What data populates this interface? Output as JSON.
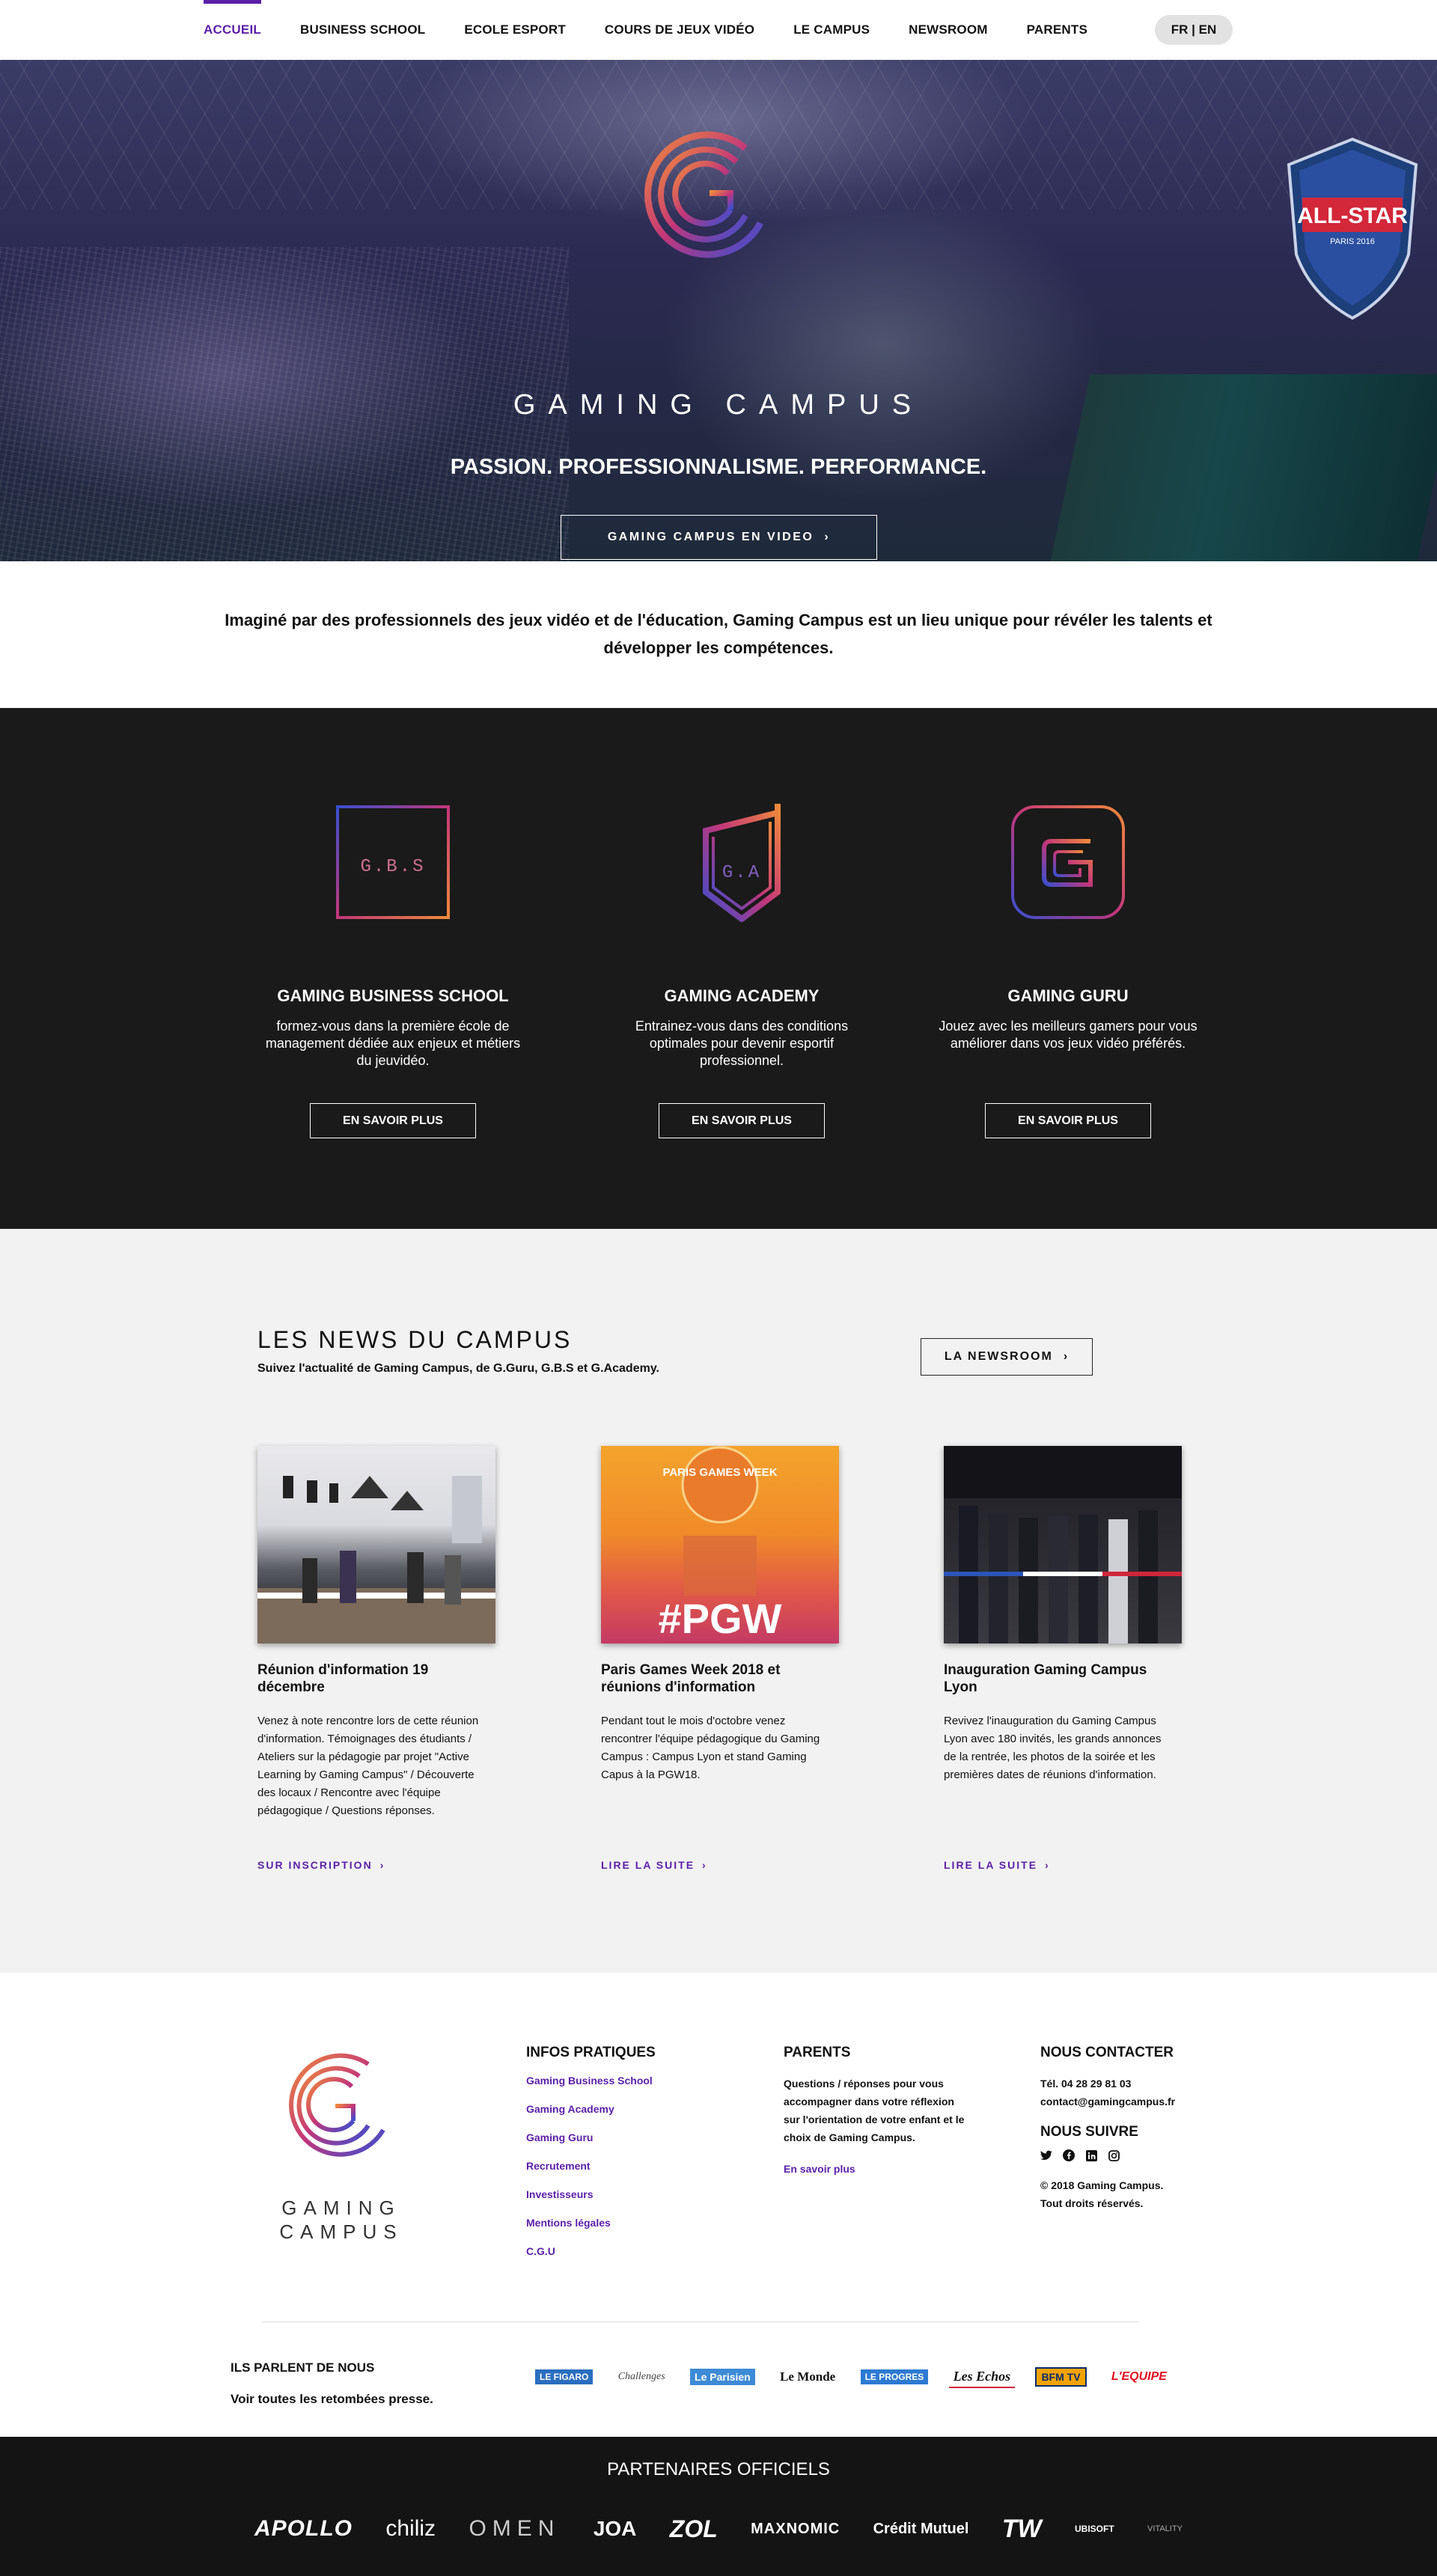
{
  "nav": {
    "items": [
      {
        "label": "ACCUEIL",
        "active": true
      },
      {
        "label": "BUSINESS SCHOOL",
        "active": false
      },
      {
        "label": "ECOLE ESPORT",
        "active": false
      },
      {
        "label": "COURS DE JEUX VIDÉO",
        "active": false
      },
      {
        "label": "LE CAMPUS",
        "active": false
      },
      {
        "label": "NEWSROOM",
        "active": false
      },
      {
        "label": "PARENTS",
        "active": false
      }
    ],
    "lang": "FR | EN",
    "active_color": "#5b1fa8"
  },
  "hero": {
    "brand": "GAMING CAMPUS",
    "tagline": "PASSION. PROFESSIONNALISME. PERFORMANCE.",
    "button": "GAMING CAMPUS EN VIDEO",
    "shield_text": "ALL-STAR",
    "shield_sub": "PARIS 2016"
  },
  "intro": "Imaginé par des professionnels des jeux vidéo et de l'éducation, Gaming Campus est un lieu unique pour révéler les talents et développer les compétences.",
  "programs": [
    {
      "logo_text": "G.B.S",
      "title": "GAMING BUSINESS SCHOOL",
      "desc": "formez-vous dans la première école de management dédiée aux enjeux et métiers du jeuvidéo.",
      "button": "EN SAVOIR PLUS"
    },
    {
      "logo_text": "G.A",
      "title": "GAMING ACADEMY",
      "desc": "Entrainez-vous dans des conditions optimales pour devenir esportif professionnel.",
      "button": "EN SAVOIR PLUS"
    },
    {
      "logo_text": "",
      "title": "GAMING GURU",
      "desc": "Jouez avec les meilleurs gamers pour vous améliorer dans vos jeux vidéo préférés.",
      "button": "EN SAVOIR PLUS"
    }
  ],
  "news": {
    "title": "LES NEWS DU CAMPUS",
    "subtitle": "Suivez l'actualité de Gaming Campus, de G.Guru, G.B.S et G.Academy.",
    "button": "LA NEWSROOM",
    "articles": [
      {
        "title": "Réunion d'information 19 décembre",
        "desc": "Venez à note rencontre lors de cette réunion d'information. Témoignages des étudiants / Ateliers sur la pédagogie par projet \"Active Learning by Gaming Campus\" / Découverte des locaux / Rencontre avec l'équipe pédagogique / Questions réponses.",
        "link": "SUR INSCRIPTION"
      },
      {
        "title": "Paris Games Week 2018 et réunions d'information",
        "desc": "Pendant tout le mois d'octobre venez rencontrer l'équipe pédagogique du Gaming Campus : Campus Lyon et stand Gaming Capus à la PGW18.",
        "link": "LIRE LA SUITE",
        "thumb_top": "PARIS GAMES WEEK",
        "thumb_tag": "#PGW"
      },
      {
        "title": "Inauguration Gaming Campus Lyon",
        "desc": "Revivez l'inauguration du Gaming Campus Lyon avec 180 invités, les grands annonces de la rentrée, les photos de la soirée et les premières dates de réunions d'information.",
        "link": "LIRE LA SUITE"
      }
    ]
  },
  "footer": {
    "brand_line1": "GAMING",
    "brand_line2": "CAMPUS",
    "infos_title": "INFOS PRATIQUES",
    "infos_links": [
      "Gaming Business School",
      "Gaming Academy",
      "Gaming Guru",
      "Recrutement",
      "Investisseurs",
      "Mentions légales",
      "C.G.U"
    ],
    "parents_title": "PARENTS",
    "parents_text": "Questions / réponses pour vous accompagner dans votre réflexion sur l'orientation de votre enfant et le choix de Gaming Campus.",
    "parents_link": "En savoir plus",
    "contact_title": "NOUS CONTACTER",
    "contact_tel": "Tél. 04 28 29 81 03",
    "contact_email": "contact@gamingcampus.fr",
    "follow_title": "NOUS SUIVRE",
    "social": [
      "twitter-icon",
      "facebook-icon",
      "linkedin-icon",
      "instagram-icon"
    ],
    "copyright_line1": "© 2018 Gaming Campus.",
    "copyright_line2": "Tout droits réservés.",
    "press_title": "ILS PARLENT DE NOUS",
    "press_link": "Voir toutes les retombées presse.",
    "press_logos": [
      "LE FIGARO",
      "Challenges",
      "Le Parisien",
      "Le Monde",
      "LE PROGRES",
      "Les Echos",
      "BFM TV",
      "L'EQUIPE"
    ]
  },
  "partners": {
    "title": "PARTENAIRES OFFICIELS",
    "logos": [
      "APOLLO",
      "chiliz",
      "OMEN",
      "JOA",
      "ZOL",
      "MAXNOMIC",
      "Crédit Mutuel",
      "TW",
      "UBISOFT",
      "VITALITY"
    ]
  }
}
